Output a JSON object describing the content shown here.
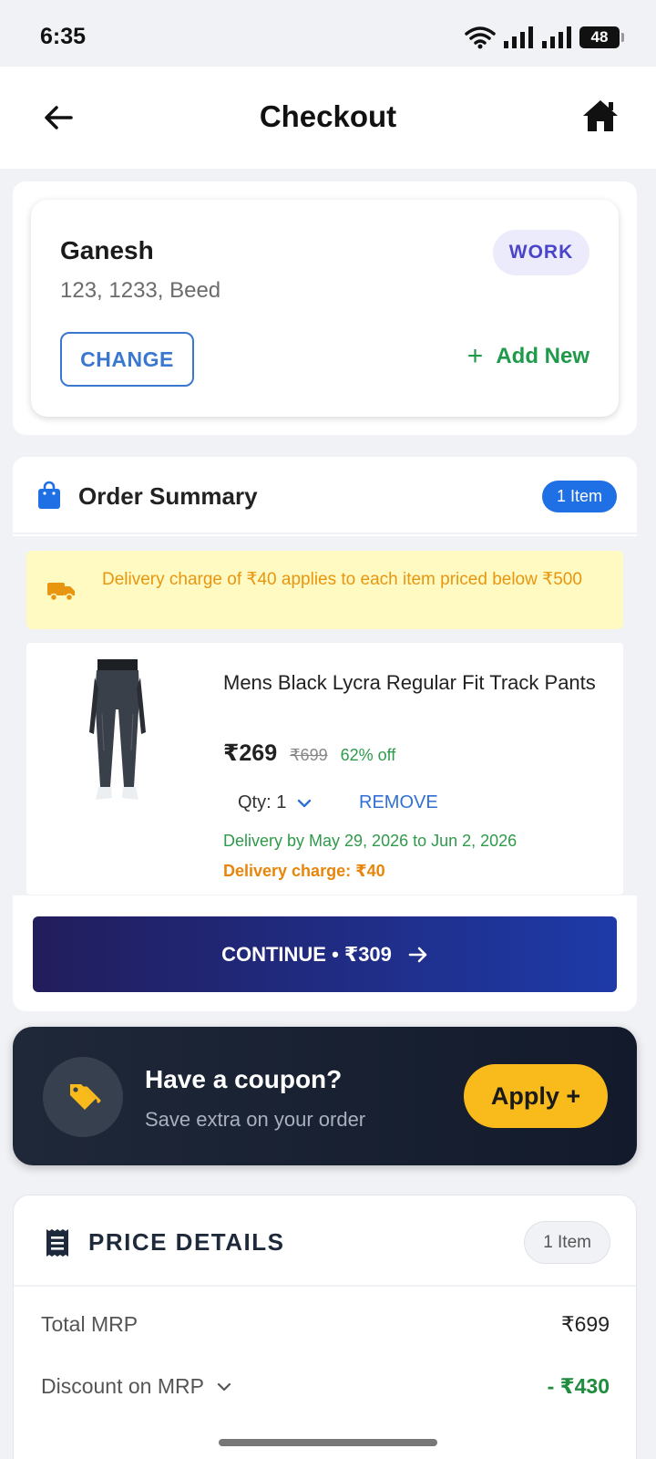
{
  "status_bar": {
    "time": "6:35",
    "battery": "48"
  },
  "header": {
    "title": "Checkout"
  },
  "address": {
    "name": "Ganesh",
    "line": "123, 1233, Beed",
    "type_badge": "WORK",
    "change_label": "CHANGE",
    "add_new_label": "Add New"
  },
  "order_summary": {
    "title": "Order Summary",
    "count_badge": "1 Item",
    "delivery_notice": "Delivery charge of ₹40 applies to each item priced below ₹500",
    "items": [
      {
        "name": "Mens Black Lycra Regular Fit Track Pants",
        "price": "₹269",
        "mrp": "₹699",
        "discount": "62% off",
        "qty_label": "Qty: 1",
        "remove_label": "REMOVE",
        "delivery_date": "Delivery by May 29, 2026 to Jun 2, 2026",
        "delivery_charge": "Delivery charge: ₹40"
      }
    ],
    "continue_label": "CONTINUE • ₹309"
  },
  "coupon": {
    "title": "Have a coupon?",
    "subtitle": "Save extra on your order",
    "apply_label": "Apply +"
  },
  "price_details": {
    "title": "PRICE DETAILS",
    "count_badge": "1 Item",
    "rows": [
      {
        "label": "Total MRP",
        "value": "₹699"
      },
      {
        "label": "Discount on MRP",
        "value": "- ₹430"
      }
    ]
  },
  "colors": {
    "accent_blue": "#1f6fe5",
    "success_green": "#1f8c3f",
    "warning_orange": "#e8960f",
    "coupon_yellow": "#f8bb1b",
    "continue_gradient_start": "#221d5c",
    "continue_gradient_end": "#1e3aa8"
  },
  "icons": {
    "back": "arrow-left-icon",
    "home": "home-icon",
    "bag": "shopping-bag-icon",
    "truck": "truck-icon",
    "coupon": "tag-icon",
    "receipt": "receipt-icon",
    "chevron": "chevron-down-icon",
    "arrow": "arrow-right-icon"
  }
}
